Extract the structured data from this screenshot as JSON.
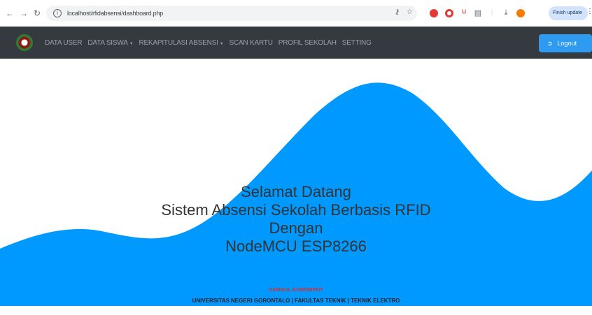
{
  "browser": {
    "url": "localhost/rfidabsensi/dashboard.php",
    "finish_update": "Finish update"
  },
  "navbar": {
    "items": [
      {
        "label": "DATA USER",
        "dropdown": false
      },
      {
        "label": "DATA SISWA",
        "dropdown": true
      },
      {
        "label": "REKAPITULASI ABSENSI",
        "dropdown": true
      },
      {
        "label": "SCAN KARTU",
        "dropdown": false
      },
      {
        "label": "PROFIL SEKOLAH",
        "dropdown": false
      },
      {
        "label": "SETTING",
        "dropdown": false
      }
    ],
    "logout_label": "Logout"
  },
  "hero": {
    "line1": "Selamat Datang",
    "line2": "Sistem Absensi Sekolah Berbasis RFID",
    "line3": "Dengan",
    "line4": "NodeMCU ESP8266",
    "author": "SAMSUL KOROMPOT",
    "institution": "UNIVERSITAS NEGERI GORONTALO | FAKULTAS TEKNIK | TEKNIK ELEKTRO"
  },
  "colors": {
    "navbar_bg": "#343a40",
    "wave": "#0099ff",
    "logout_bg": "#2e9bf0",
    "author_text": "#d32f2f"
  }
}
